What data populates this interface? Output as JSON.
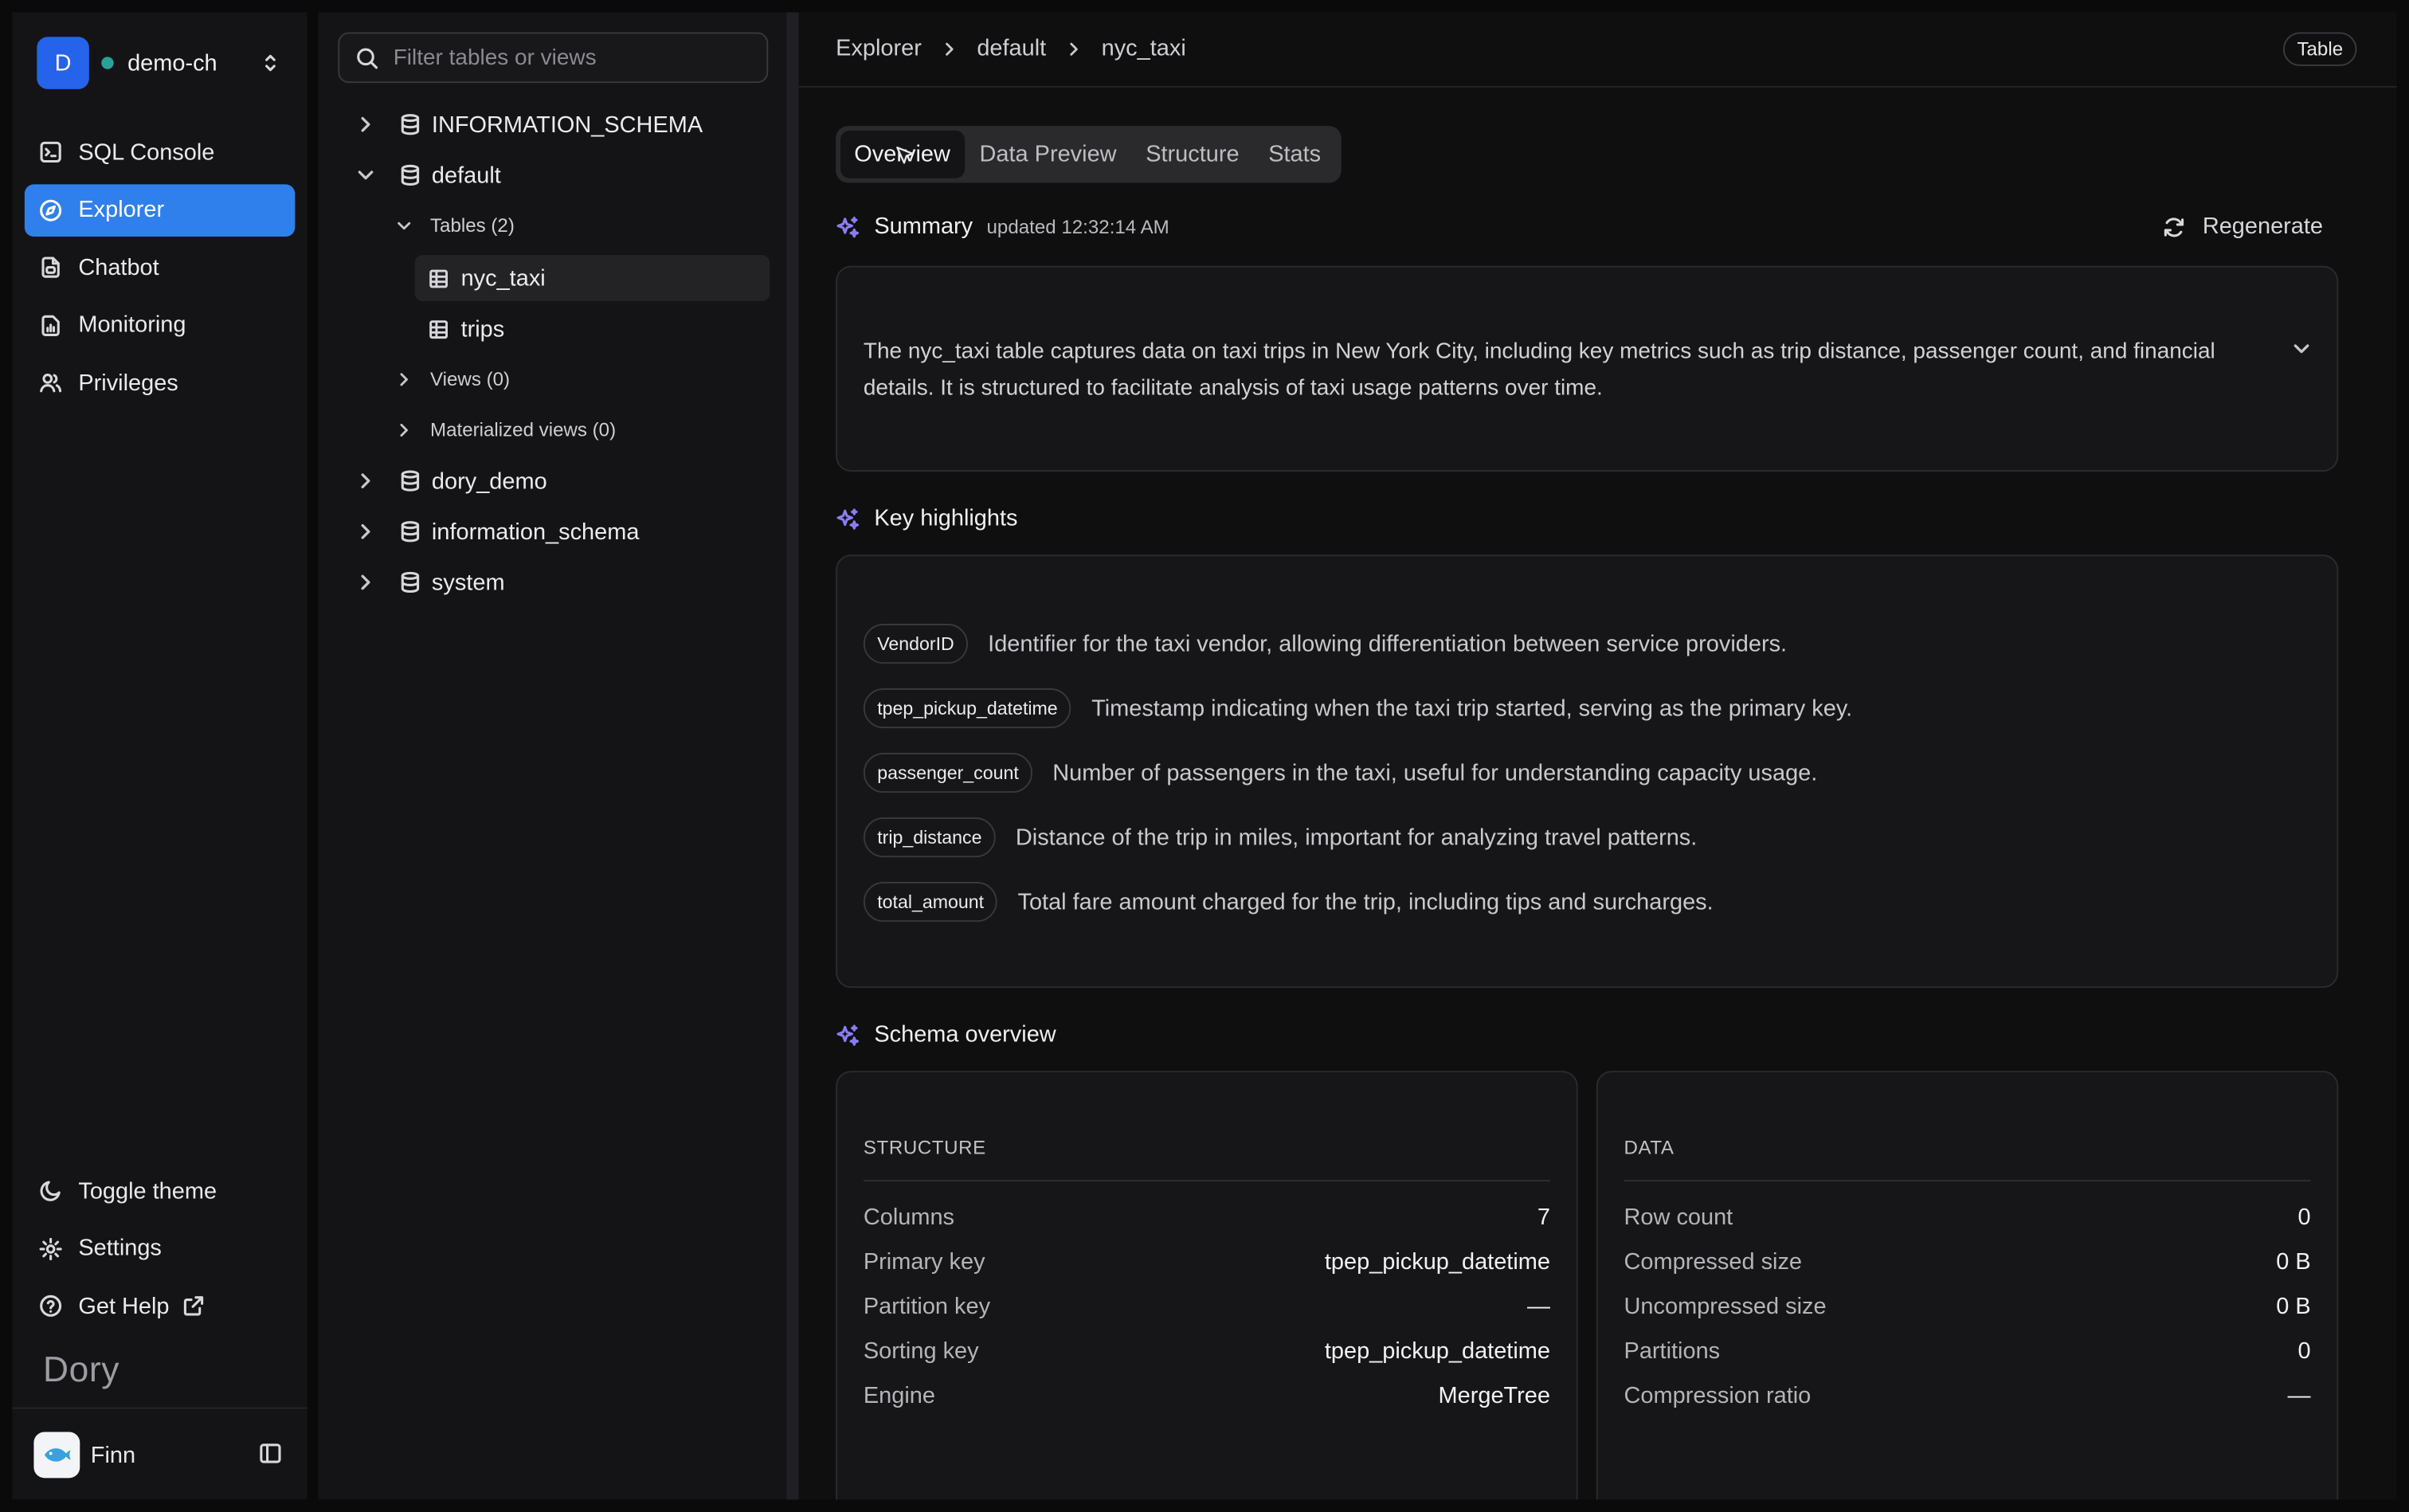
{
  "workspace": {
    "initial": "D",
    "name": "demo-ch"
  },
  "nav": {
    "items": [
      {
        "label": "SQL Console",
        "icon": "terminal-icon"
      },
      {
        "label": "Explorer",
        "icon": "compass-icon"
      },
      {
        "label": "Chatbot",
        "icon": "chatbot-icon"
      },
      {
        "label": "Monitoring",
        "icon": "monitoring-icon"
      },
      {
        "label": "Privileges",
        "icon": "users-icon"
      }
    ],
    "active": "Explorer",
    "bottom": [
      {
        "label": "Toggle theme",
        "icon": "moon-icon"
      },
      {
        "label": "Settings",
        "icon": "gear-icon"
      },
      {
        "label": "Get Help",
        "icon": "help-icon"
      }
    ],
    "brand": "Dory",
    "user": "Finn"
  },
  "tree": {
    "filter_placeholder": "Filter tables or views",
    "databases": [
      {
        "name": "INFORMATION_SCHEMA"
      },
      {
        "name": "default"
      },
      {
        "name": "dory_demo"
      },
      {
        "name": "information_schema"
      },
      {
        "name": "system"
      }
    ],
    "default_groups": {
      "tables": "Tables (2)",
      "views": "Views (0)",
      "mviews": "Materialized views (0)"
    },
    "tables": [
      {
        "name": "nyc_taxi"
      },
      {
        "name": "trips"
      }
    ],
    "selected": "nyc_taxi"
  },
  "breadcrumb": [
    "Explorer",
    "default",
    "nyc_taxi"
  ],
  "object_type": "Table",
  "tabs": [
    "Overview",
    "Data Preview",
    "Structure",
    "Stats"
  ],
  "active_tab": "Overview",
  "summary": {
    "title": "Summary",
    "updated": "updated 12:32:14 AM",
    "regenerate": "Regenerate",
    "text": "The nyc_taxi table captures data on taxi trips in New York City, including key metrics such as trip distance, passenger count, and financial details. It is structured to facilitate analysis of taxi usage patterns over time."
  },
  "highlights": {
    "title": "Key highlights",
    "items": [
      {
        "column": "VendorID",
        "text": "Identifier for the taxi vendor, allowing differentiation between service providers."
      },
      {
        "column": "tpep_pickup_datetime",
        "text": "Timestamp indicating when the taxi trip started, serving as the primary key."
      },
      {
        "column": "passenger_count",
        "text": "Number of passengers in the taxi, useful for understanding capacity usage."
      },
      {
        "column": "trip_distance",
        "text": "Distance of the trip in miles, important for analyzing travel patterns."
      },
      {
        "column": "total_amount",
        "text": "Total fare amount charged for the trip, including tips and surcharges."
      }
    ]
  },
  "schema": {
    "title": "Schema overview",
    "structure": {
      "label": "STRUCTURE",
      "rows": [
        {
          "k": "Columns",
          "v": "7"
        },
        {
          "k": "Primary key",
          "v": "tpep_pickup_datetime"
        },
        {
          "k": "Partition key",
          "v": "—"
        },
        {
          "k": "Sorting key",
          "v": "tpep_pickup_datetime"
        },
        {
          "k": "Engine",
          "v": "MergeTree"
        }
      ]
    },
    "data": {
      "label": "DATA",
      "rows": [
        {
          "k": "Row count",
          "v": "0"
        },
        {
          "k": "Compressed size",
          "v": "0 B"
        },
        {
          "k": "Uncompressed size",
          "v": "0 B"
        },
        {
          "k": "Partitions",
          "v": "0"
        },
        {
          "k": "Compression ratio",
          "v": "—"
        }
      ]
    }
  },
  "colors": {
    "accent": "#2f80ed",
    "workspace_avatar": "#2563eb",
    "status_dot": "#2aa198",
    "sparkle": "#8b7cf6"
  }
}
